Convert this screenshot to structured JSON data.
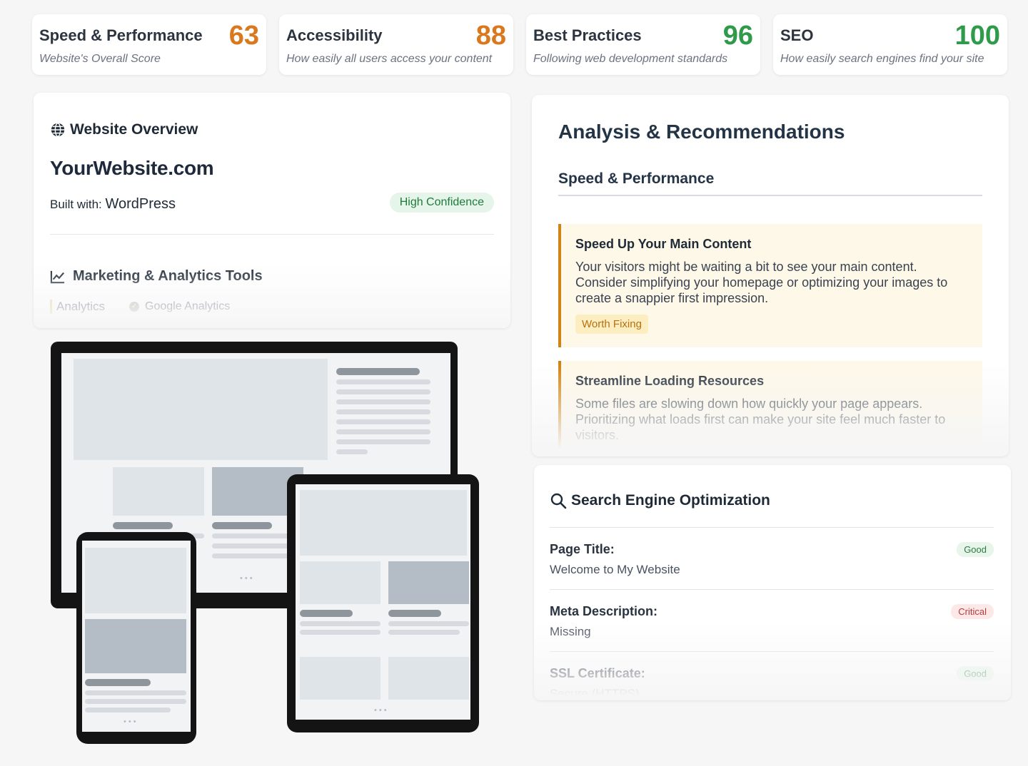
{
  "scores": [
    {
      "title": "Speed & Performance",
      "value": "63",
      "subtitle": "Website's Overall Score",
      "color": "#d9781c"
    },
    {
      "title": "Accessibility",
      "value": "88",
      "subtitle": "How easily all users access your content",
      "color": "#d9781c"
    },
    {
      "title": "Best Practices",
      "value": "96",
      "subtitle": "Following web development standards",
      "color": "#2e9a4a"
    },
    {
      "title": "SEO",
      "value": "100",
      "subtitle": "How easily search engines find your site",
      "color": "#2e9a4a"
    }
  ],
  "overview": {
    "heading": "Website Overview",
    "heading_icon": "globe-icon",
    "site": "YourWebsite.com",
    "built_label": "Built with:",
    "built_value": "WordPress",
    "confidence": "High Confidence",
    "marketing_heading": "Marketing & Analytics Tools",
    "marketing_icon": "line-chart-icon",
    "category": "Analytics",
    "tool": "Google Analytics"
  },
  "analysis": {
    "title": "Analysis & Recommendations",
    "tab": "Speed & Performance",
    "recommendations": [
      {
        "title": "Speed Up Your Main Content",
        "body": "Your visitors might be waiting a bit to see your main content. Consider simplifying your homepage or optimizing your images to create a snappier first impression.",
        "badge": "Worth Fixing"
      },
      {
        "title": "Streamline Loading Resources",
        "body": "Some files are slowing down how quickly your page appears. Prioritizing what loads first can make your site feel much faster to visitors.",
        "badge": ""
      }
    ]
  },
  "seo": {
    "heading": "Search Engine Optimization",
    "heading_icon": "search-icon",
    "rows": [
      {
        "label": "Page Title:",
        "value": "Welcome to My Website",
        "status": "Good"
      },
      {
        "label": "Meta Description:",
        "value": "Missing",
        "status": "Critical"
      },
      {
        "label": "SSL Certificate:",
        "value": "Secure (HTTPS)",
        "status": "Good"
      }
    ]
  },
  "illustration": {
    "devices": [
      "desktop-monitor",
      "tablet",
      "phone"
    ],
    "pager_dots": "•••"
  }
}
